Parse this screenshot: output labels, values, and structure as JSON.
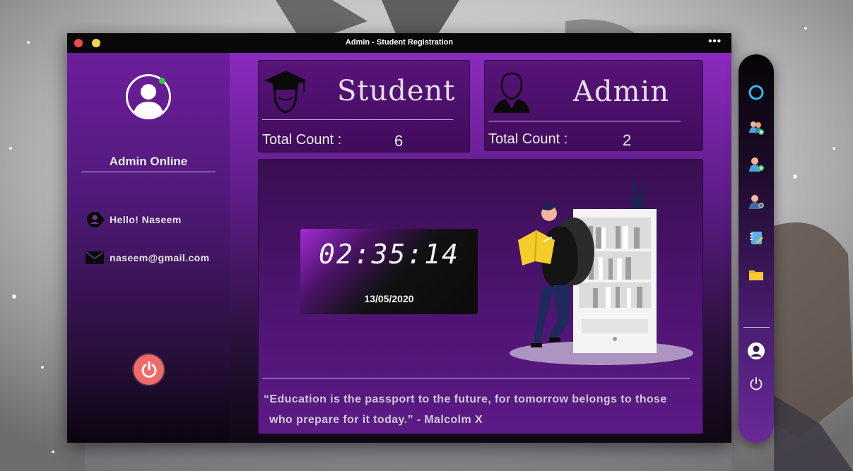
{
  "window": {
    "title": "Admin - Student Registration",
    "menu_glyph": "•••"
  },
  "sidebar": {
    "status_label": "Admin Online",
    "greeting": "Hello!  Naseem",
    "email": "naseem@gmail.com"
  },
  "cards": {
    "student": {
      "title": "Student",
      "count_label": "Total Count :",
      "count": "6"
    },
    "admin": {
      "title": "Admin",
      "count_label": "Total Count :",
      "count": "2"
    }
  },
  "clock": {
    "time": "02:35:14",
    "date": "13/05/2020"
  },
  "quote": {
    "line1": "“Education is the passport to the future, for tomorrow belongs to those",
    "line2": "who prepare for it today.”  -  Malcolm X"
  },
  "dock": {
    "items": [
      "circle-icon",
      "add-student-icon",
      "add-admin-icon",
      "manage-users-icon",
      "notes-icon",
      "folder-icon",
      "profile-icon",
      "power-icon"
    ]
  },
  "colors": {
    "accent_purple": "#8b2ac0",
    "online_green": "#28d13a",
    "power_red": "#f06a6a",
    "close_red": "#ef4b4b",
    "minimize_yellow": "#f3d64a"
  }
}
